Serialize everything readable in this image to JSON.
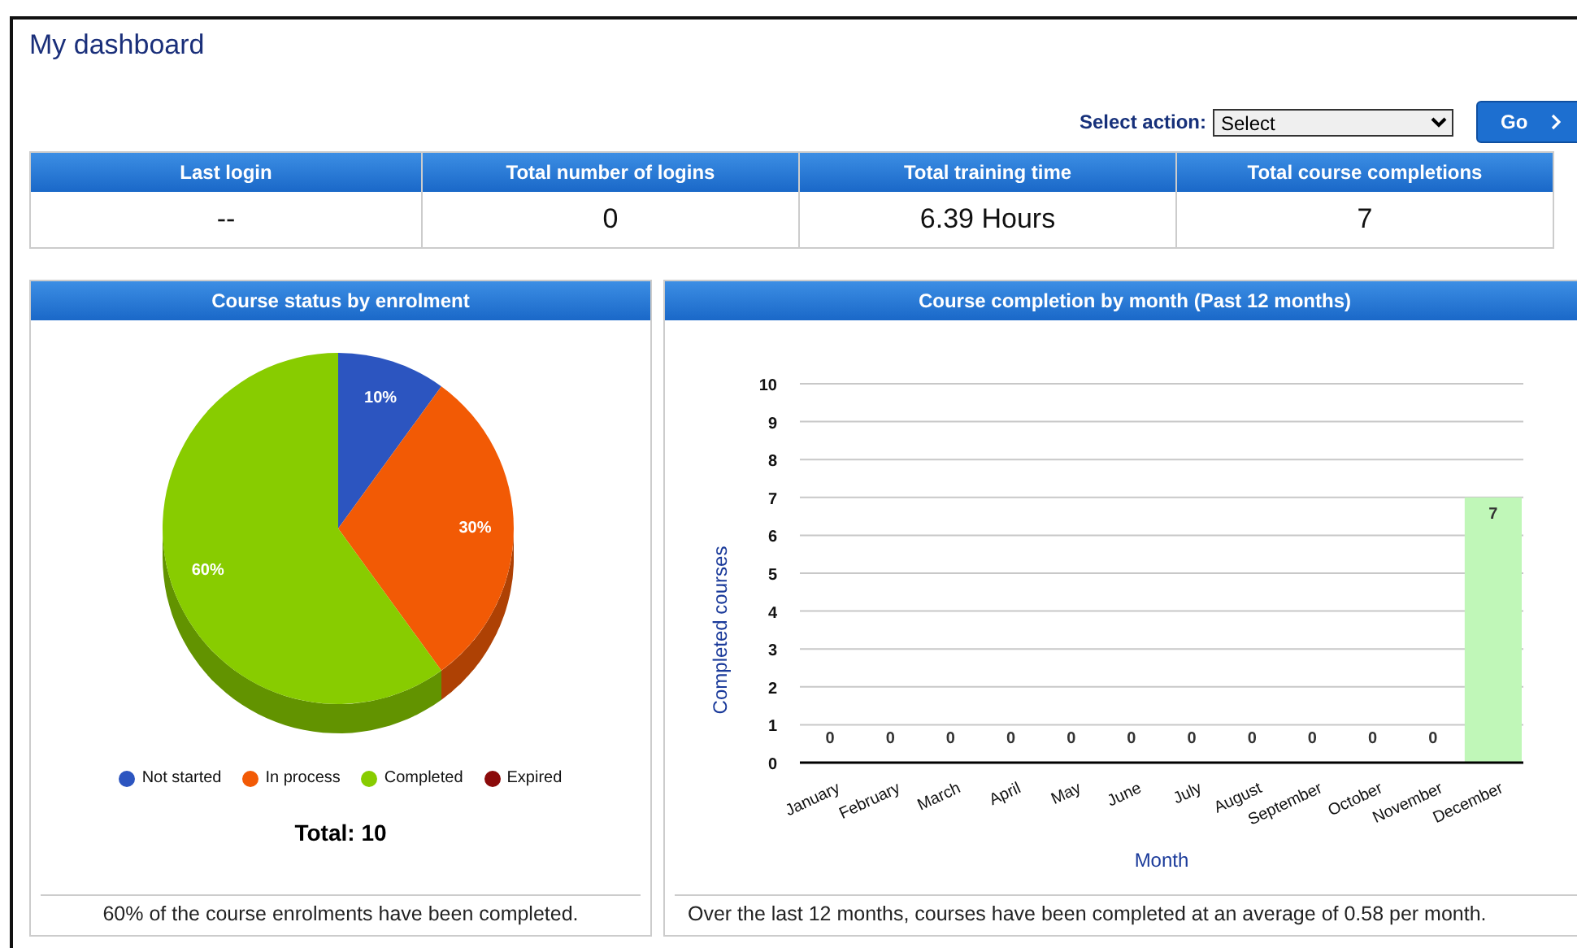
{
  "page": {
    "title": "My dashboard"
  },
  "action": {
    "label": "Select action:",
    "value": "Select",
    "button": "Go"
  },
  "stats": [
    {
      "label": "Last login",
      "value": "--"
    },
    {
      "label": "Total number of logins",
      "value": "0"
    },
    {
      "label": "Total training time",
      "value": "6.39 Hours"
    },
    {
      "label": "Total course completions",
      "value": "7"
    }
  ],
  "status_panel": {
    "title": "Course status by enrolment",
    "chart_data": {
      "type": "pie",
      "categories": [
        "Not started",
        "In process",
        "Completed",
        "Expired"
      ],
      "values": [
        10,
        30,
        60,
        0
      ],
      "value_labels": [
        "10%",
        "30%",
        "60%",
        null
      ]
    },
    "legend": [
      {
        "color": "#2c55c0"
      },
      {
        "color": "#f25a05"
      },
      {
        "color": "#88cc00"
      },
      {
        "color": "#8b0a0a"
      }
    ],
    "total": "Total: 10",
    "summary": "60% of the course enrolments have been completed."
  },
  "monthly_panel": {
    "title": "Course completion by month (Past 12 months)",
    "chart_data": {
      "type": "bar",
      "xlabel": "Month",
      "ylabel": "Completed courses",
      "categories": [
        "January",
        "February",
        "March",
        "April",
        "May",
        "June",
        "July",
        "August",
        "September",
        "October",
        "November",
        "December"
      ],
      "series": [
        {
          "color": "#c0f7b8",
          "values": [
            0,
            0,
            0,
            0,
            0,
            0,
            0,
            0,
            0,
            0,
            0,
            7
          ]
        }
      ],
      "ylim": [
        0,
        10
      ],
      "yticks": [
        0,
        1,
        2,
        3,
        4,
        5,
        6,
        7,
        8,
        9,
        10
      ],
      "data_labels": true,
      "grid": true
    },
    "summary": "Over the last 12 months, courses have been completed at an average of 0.58 per month."
  }
}
